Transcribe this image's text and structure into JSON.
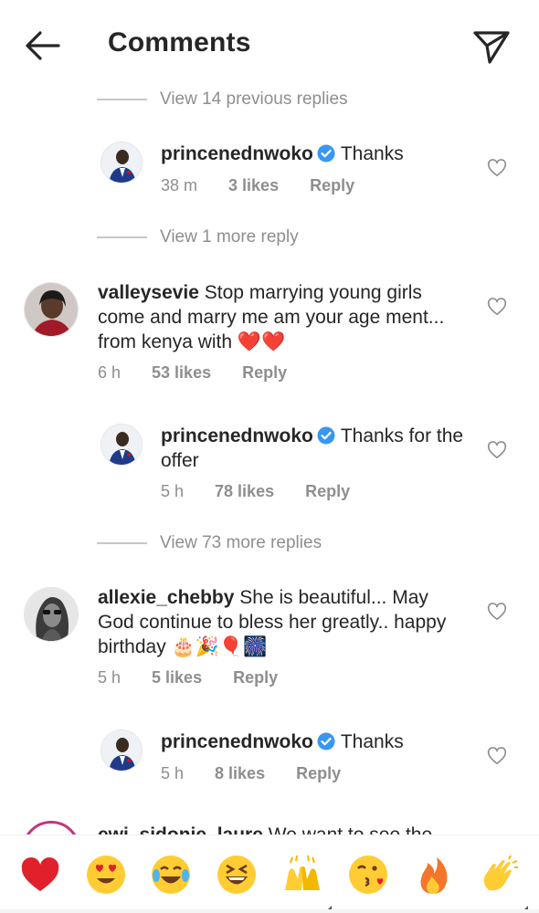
{
  "header": {
    "title": "Comments"
  },
  "view_replies": [
    {
      "text": "View 14 previous replies"
    },
    {
      "text": "View 1 more reply"
    },
    {
      "text": "View 73 more replies"
    }
  ],
  "comments": [
    {
      "username": "princenednwoko",
      "verified": true,
      "text": "Thanks",
      "time": "38 m",
      "likes": "3 likes",
      "reply": "Reply"
    },
    {
      "username": "valleysevie",
      "verified": false,
      "text": "Stop marrying young girls come and marry me am your age ment... from kenya with ❤️❤️",
      "time": "6 h",
      "likes": "53 likes",
      "reply": "Reply"
    },
    {
      "username": "princenednwoko",
      "verified": true,
      "text": "Thanks for the offer",
      "time": "5 h",
      "likes": "78 likes",
      "reply": "Reply"
    },
    {
      "username": "allexie_chebby",
      "verified": false,
      "text": "She is beautiful... May God continue to bless her greatly.. happy birthday 🎂🎉🎈🎆",
      "time": "5 h",
      "likes": "5 likes",
      "reply": "Reply"
    },
    {
      "username": "princenednwoko",
      "verified": true,
      "text": "Thanks",
      "time": "5 h",
      "likes": "8 likes",
      "reply": "Reply"
    }
  ],
  "partial_comment": {
    "username": "ewi_sidonie_laure",
    "text": "We want to see the"
  },
  "emoji_bar": [
    "❤️",
    "😍",
    "😂",
    "😆",
    "🙌",
    "😘",
    "🔥",
    "👏"
  ],
  "colors": {
    "verified": "#3897f0",
    "muted": "#8e8e8e",
    "text": "#262626"
  }
}
